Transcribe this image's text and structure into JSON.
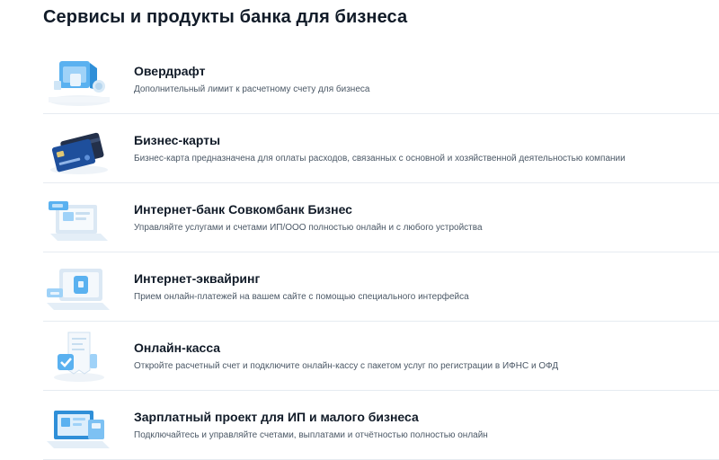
{
  "page": {
    "title": "Сервисы и продукты банка для бизнеса"
  },
  "products": [
    {
      "icon": "overdraft-illustration-icon",
      "title": "Овердрафт",
      "description": "Дополнительный лимит к расчетному счету для бизнеса"
    },
    {
      "icon": "business-cards-illustration-icon",
      "title": "Бизнес-карты",
      "description": "Бизнес-карта предназначена для оплаты расходов, связанных с основной и хозяйственной деятельностью компании"
    },
    {
      "icon": "internet-bank-illustration-icon",
      "title": "Интернет-банк Совкомбанк Бизнес",
      "description": "Управляйте услугами и счетами ИП/ООО полностью онлайн и с любого устройства"
    },
    {
      "icon": "internet-acquiring-illustration-icon",
      "title": "Интернет-эквайринг",
      "description": "Прием онлайн-платежей на вашем сайте с помощью специального интерфейса"
    },
    {
      "icon": "online-cashbox-illustration-icon",
      "title": "Онлайн-касса",
      "description": "Откройте расчетный счет и подключите онлайн-кассу с пакетом услуг по регистрации в ИФНС и ОФД"
    },
    {
      "icon": "payroll-project-illustration-icon",
      "title": "Зарплатный проект для ИП и малого бизнеса",
      "description": "Подключайтесь и управляйте счетами, выплатами и отчётностью полностью онлайн"
    }
  ],
  "colors": {
    "accent": "#2f9be8",
    "light": "#dceefc",
    "text": "#111b28",
    "muted": "#4b5866",
    "divider": "#e6ebf1"
  }
}
